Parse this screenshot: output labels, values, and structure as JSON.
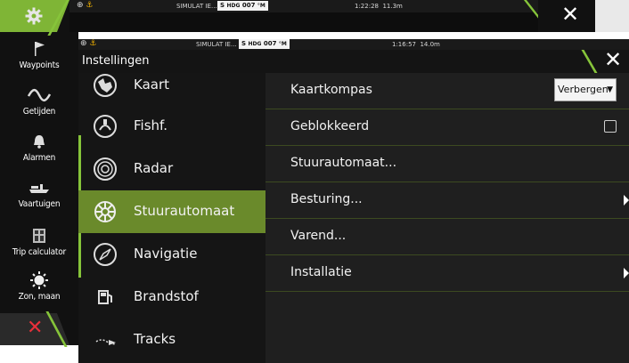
{
  "background": {
    "sidebar": [
      {
        "icon": "flag-icon",
        "label": "Waypoints"
      },
      {
        "icon": "tide-wave-icon",
        "label": "Getijden"
      },
      {
        "icon": "bell-icon",
        "label": "Alarmen"
      },
      {
        "icon": "boat-icon",
        "label": "Vaartuigen"
      },
      {
        "icon": "calculator-icon",
        "label": "Trip calculator"
      },
      {
        "icon": "sun-icon",
        "label": "Zon, maan"
      }
    ],
    "status": {
      "sim": "SIMULAT IE...",
      "hdg_prefix": "S",
      "hdg_label": "HDG",
      "hdg_value": "007",
      "hdg_unit": "°M",
      "time": "1:22:28",
      "distance": "11.3m"
    }
  },
  "dialog": {
    "status": {
      "sim": "SIMULAT IE...",
      "hdg_prefix": "S",
      "hdg_label": "HDG",
      "hdg_value": "007",
      "hdg_unit": "°M",
      "time": "1:16:57",
      "distance": "14.0m"
    },
    "title": "Instellingen",
    "menu": [
      {
        "icon": "chart-icon",
        "label": "Kaart"
      },
      {
        "icon": "echosounder-icon",
        "label": "Fishf."
      },
      {
        "icon": "radar-icon",
        "label": "Radar"
      },
      {
        "icon": "steering-wheel-icon",
        "label": "Stuurautomaat",
        "active": true
      },
      {
        "icon": "compass-icon",
        "label": "Navigatie"
      },
      {
        "icon": "fuel-pump-icon",
        "label": "Brandstof"
      },
      {
        "icon": "tracks-icon",
        "label": "Tracks"
      }
    ],
    "settings": [
      {
        "label": "Kaartkompas",
        "control": "dropdown",
        "value": "Verbergen"
      },
      {
        "label": "Geblokkeerd",
        "control": "checkbox",
        "checked": false
      },
      {
        "label": "Stuurautomaat...",
        "control": "none"
      },
      {
        "label": "Besturing...",
        "control": "arrow"
      },
      {
        "label": "Varend...",
        "control": "none"
      },
      {
        "label": "Installatie",
        "control": "arrow"
      }
    ]
  },
  "colors": {
    "accent": "#86c43a",
    "active": "#6a8a2b",
    "alert": "#e8303a"
  }
}
